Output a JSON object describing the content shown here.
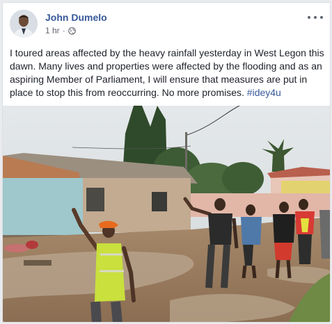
{
  "author": {
    "name": "John Dumelo"
  },
  "timestamp": "1 hr",
  "privacy_icon": "globe-icon",
  "more_icon": "ellipsis-icon",
  "post": {
    "text": "I toured areas affected by the heavy rainfall yesterday in West Legon this dawn. Many lives and properties were affected by the flooding and as an aspiring Member of Parliament, I will ensure that measures are put in place to stop this from reoccurring. No more promises.",
    "hashtag": "#idey4u"
  },
  "colors": {
    "link": "#365899",
    "text": "#1d2129",
    "meta": "#616770"
  }
}
